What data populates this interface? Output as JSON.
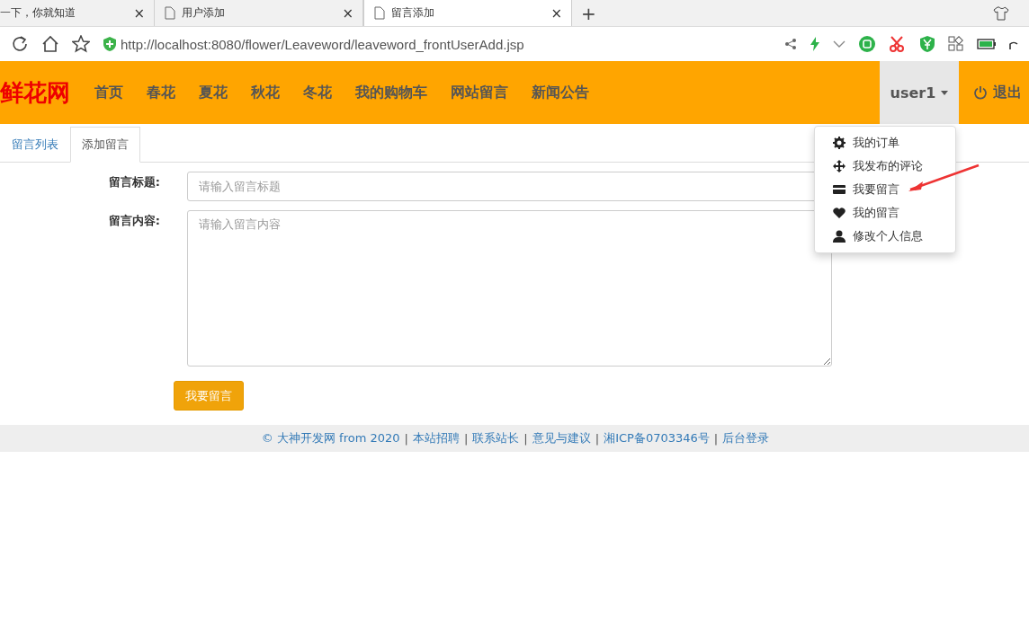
{
  "browser": {
    "tabs": [
      {
        "title": "一下，你就知道",
        "close": "×",
        "selected": false
      },
      {
        "title": "用户添加",
        "close": "×",
        "selected": false
      },
      {
        "title": "留言添加",
        "close": "×",
        "selected": true
      }
    ],
    "new_tab": "+",
    "url": "http://localhost:8080/flower/Leaveword/leaveword_frontUserAdd.jsp"
  },
  "navbar": {
    "brand": "鲜花网",
    "items": [
      {
        "label": "首页"
      },
      {
        "label": "春花"
      },
      {
        "label": "夏花"
      },
      {
        "label": "秋花"
      },
      {
        "label": "冬花"
      },
      {
        "label": "我的购物车"
      },
      {
        "label": "网站留言"
      },
      {
        "label": "新闻公告"
      }
    ],
    "user": {
      "label": "user1",
      "expanded": true
    },
    "logout": "退出"
  },
  "user_menu": [
    {
      "label": "我的订单",
      "kind": "gear"
    },
    {
      "label": "我发布的评论",
      "kind": "move"
    },
    {
      "label": "我要留言",
      "kind": "card"
    },
    {
      "label": "我的留言",
      "kind": "heart"
    },
    {
      "label": "修改个人信息",
      "kind": "user"
    }
  ],
  "tabs": [
    {
      "label": "留言列表",
      "selected": false
    },
    {
      "label": "添加留言",
      "selected": true
    }
  ],
  "form": {
    "fields": [
      {
        "label": "留言标题:",
        "placeholder": "请输入留言标题",
        "kind": "input"
      },
      {
        "label": "留言内容:",
        "placeholder": "请输入留言内容",
        "kind": "textarea"
      }
    ],
    "submit": "我要留言"
  },
  "footer": [
    {
      "text": "© 大神开发网 from 2020"
    },
    {
      "text": "本站招聘"
    },
    {
      "text": "联系站长"
    },
    {
      "text": "意见与建议"
    },
    {
      "text": "湘ICP备0703346号"
    },
    {
      "text": "后台登录"
    }
  ],
  "footer_separator": "|"
}
